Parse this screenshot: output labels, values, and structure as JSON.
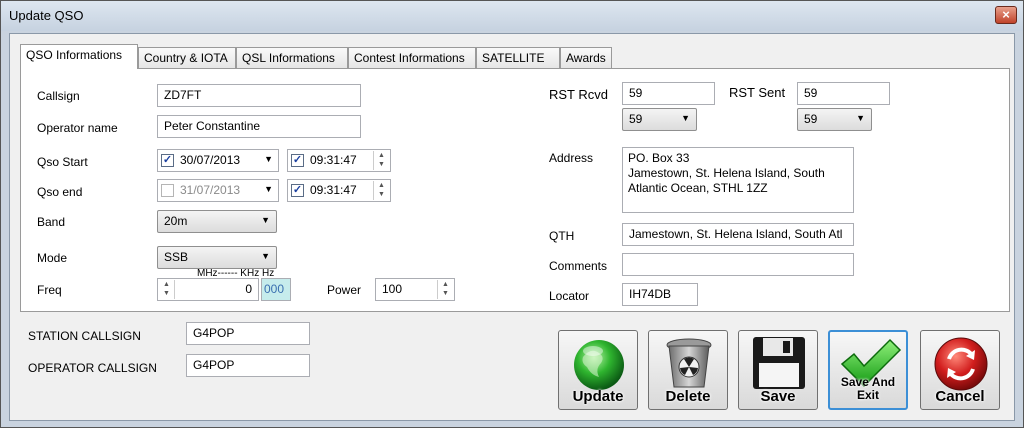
{
  "window": {
    "title": "Update QSO",
    "close_icon": "×"
  },
  "tabs": [
    {
      "label": "QSO Informations",
      "active": true
    },
    {
      "label": "Country & IOTA"
    },
    {
      "label": "QSL Informations"
    },
    {
      "label": "Contest Informations"
    },
    {
      "label": "SATELLITE"
    },
    {
      "label": "Awards"
    }
  ],
  "qso": {
    "callsign_label": "Callsign",
    "callsign": "ZD7FT",
    "operator_name_label": "Operator name",
    "operator_name": "Peter Constantine",
    "qso_start_label": "Qso Start",
    "qso_start_date": "30/07/2013",
    "qso_start_time": "09:31:47",
    "qso_end_label": "Qso end",
    "qso_end_date": "31/07/2013",
    "qso_end_time": "09:31:47",
    "band_label": "Band",
    "band": "20m",
    "mode_label": "Mode",
    "mode": "SSB",
    "freq_label": "Freq",
    "freq_units": "MHz------ KHz  Hz",
    "freq_value": "0",
    "freq_hz": "000",
    "power_label": "Power",
    "power": "100",
    "rst_rcvd_label": "RST Rcvd",
    "rst_rcvd": "59",
    "rst_rcvd_combo": "59",
    "rst_sent_label": "RST Sent",
    "rst_sent": "59",
    "rst_sent_combo": "59",
    "address_label": "Address",
    "address": "PO. Box 33\nJamestown, St. Helena Island, South\nAtlantic Ocean, STHL 1ZZ",
    "qth_label": "QTH",
    "qth": "Jamestown, St. Helena Island, South Atl",
    "comments_label": "Comments",
    "comments": "",
    "locator_label": "Locator",
    "locator": "IH74DB"
  },
  "station": {
    "station_callsign_label": "STATION CALLSIGN",
    "station_callsign": "G4POP",
    "operator_callsign_label": "OPERATOR CALLSIGN",
    "operator_callsign": "G4POP"
  },
  "buttons": {
    "update": "Update",
    "delete": "Delete",
    "save": "Save",
    "save_exit_line1": "Save And",
    "save_exit_line2": "Exit",
    "cancel": "Cancel"
  },
  "icons": [
    "globe-icon",
    "trash-icon",
    "floppy-disk-icon",
    "checkmark-icon",
    "cancel-refresh-icon"
  ],
  "colors": {
    "title_bar": "#c6d2e0",
    "hz_highlight": "#c6ecec",
    "cancel_red": "#d21e1e",
    "globe_green": "#1fa11f"
  }
}
